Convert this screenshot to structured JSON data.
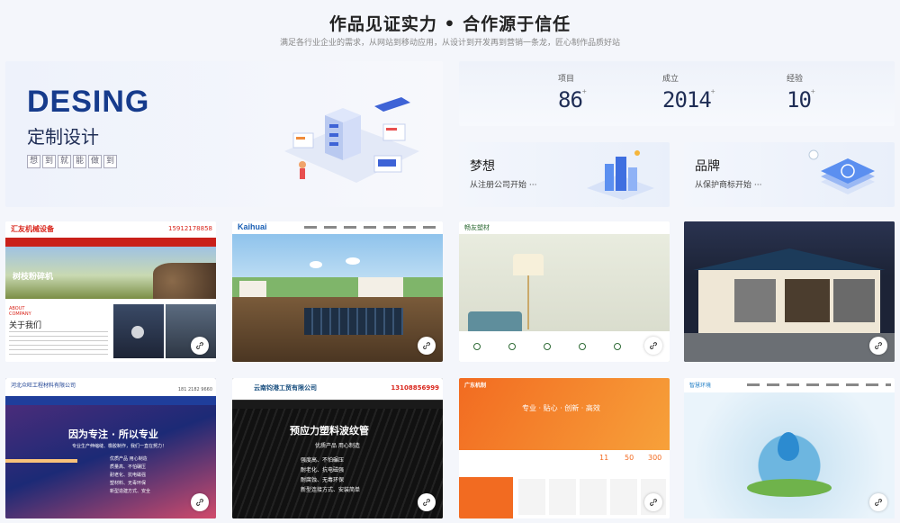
{
  "header": {
    "title": "作品见证实力 • 合作源于信任",
    "subtitle": "满足各行业企业的需求，从网站到移动应用，从设计到开发再到营销一条龙，匠心制作品质好站"
  },
  "hero": {
    "title_en": "DESING",
    "title_cn": "定制设计",
    "tags": [
      "想",
      "到",
      "就",
      "能",
      "做",
      "到"
    ]
  },
  "stats": [
    {
      "label": "项目",
      "value": "86",
      "suffix": "+"
    },
    {
      "label": "成立",
      "value": "2014",
      "suffix": "+"
    },
    {
      "label": "经验",
      "value": "10",
      "suffix": "+"
    }
  ],
  "cards": {
    "dream": {
      "title": "梦想",
      "subtitle": "从注册公司开始 ···"
    },
    "brand": {
      "title": "品牌",
      "subtitle": "从保护商标开始 ···"
    }
  },
  "portfolio": {
    "t1": {
      "brand": "汇友机械设备",
      "phone": "15912178858",
      "banner_text": "树枝粉碎机",
      "about_en": "ABOUT COMPANY",
      "about_cn": "关于我们"
    },
    "t2": {
      "brand": "Kaihuai"
    },
    "t3": {
      "brand": "畅友塑材"
    },
    "t4": {},
    "t5": {
      "brand": "河北众旺工程材料有限公司",
      "phone": "181 2182 9660",
      "headline": "因为专注 · 所以专业",
      "sub": "专业生产伸缩缝、橡胶制作，我们一直在努力！",
      "list": [
        "优质产品 用心制造",
        "质量高、不怕碾压",
        "耐老化、抗电磁强",
        "塑材料、无毒环保",
        "新型造建方式、安全"
      ]
    },
    "t6": {
      "brand": "云南钧港工贸有限公司",
      "phone": "13108856999",
      "headline": "预应力塑料波纹管",
      "sub": "优质产品 用心制造",
      "list": [
        "强度高、不怕碾压",
        "耐老化、抗电磁强",
        "耐腐蚀、无毒环保",
        "新型连接方式、安装简单"
      ]
    },
    "t7": {
      "brand": "广东机制",
      "headline": "专业 · 贴心 · 创新 · 高效",
      "stats": [
        "11",
        "50",
        "300"
      ]
    },
    "t8": {
      "brand": "智慧环境"
    }
  },
  "colors": {
    "primary": "#163b8c",
    "accent_red": "#d9261c",
    "accent_orange": "#f26b21"
  }
}
